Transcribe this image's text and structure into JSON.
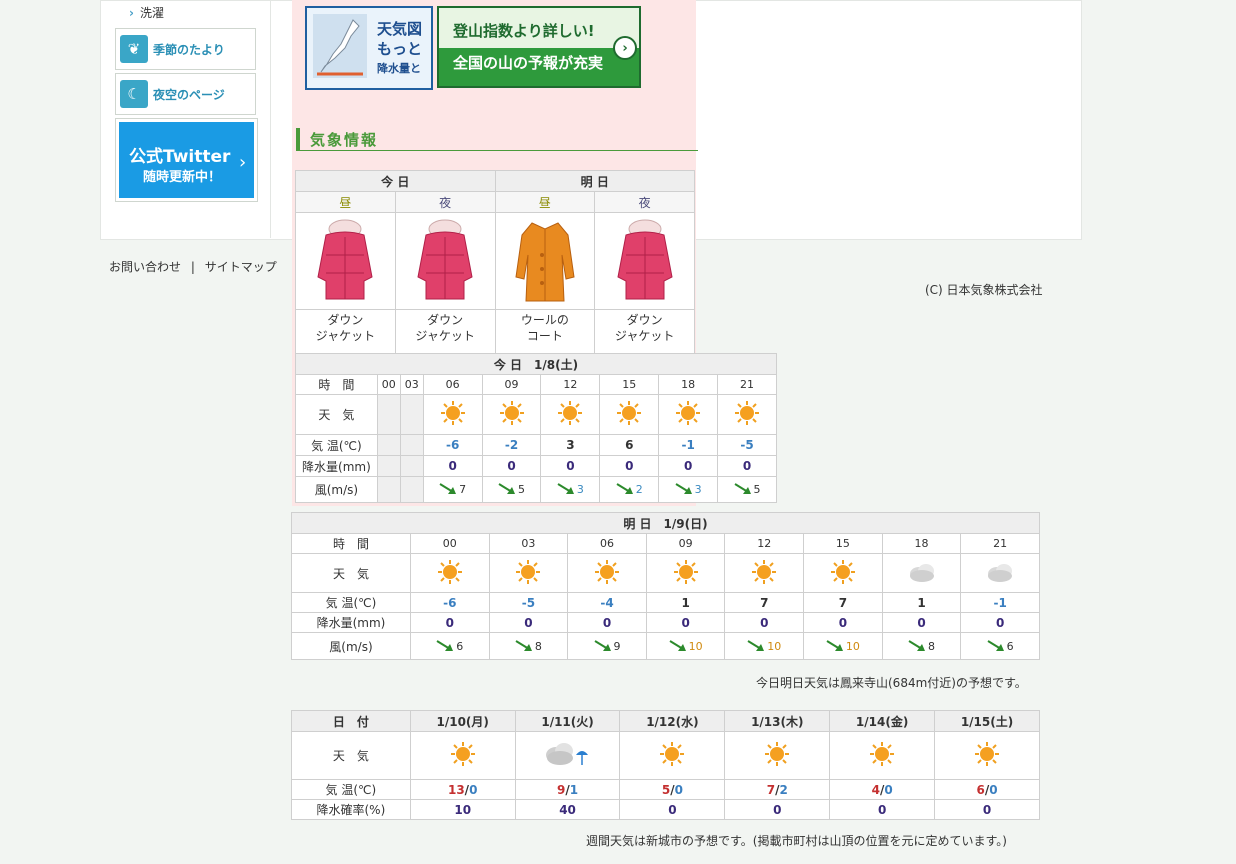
{
  "sidebar": {
    "laundry_label": "洗濯",
    "season_label": "季節のたより",
    "night_label": "夜空のページ",
    "twitter_line1": "公式Twitter",
    "twitter_line2": "随時更新中！"
  },
  "banners": {
    "weather_map_lines": [
      "天気図",
      "もっと",
      "降水量と"
    ],
    "mountain_line1": "登山指数より詳しい!",
    "mountain_line2": "全国の山の予報が充実"
  },
  "footer": {
    "contact": "お問い合わせ",
    "sep": "|",
    "sitemap": "サイトマップ",
    "copyright": "(C) 日本気象株式会社"
  },
  "section_title": "気象情報",
  "clothing": {
    "today": "今 日",
    "tomorrow": "明 日",
    "day_label": "昼",
    "night_label": "夜",
    "items": [
      {
        "line1": "ダウン",
        "line2": "ジャケット",
        "icon": "down-jacket-icon"
      },
      {
        "line1": "ダウン",
        "line2": "ジャケット",
        "icon": "down-jacket-icon"
      },
      {
        "line1": "ウールの",
        "line2": "コート",
        "icon": "wool-coat-icon"
      },
      {
        "line1": "ダウン",
        "line2": "ジャケット",
        "icon": "down-jacket-icon"
      }
    ]
  },
  "today_forecast": {
    "caption": "今 日　1/8(土)",
    "row_time": "時　間",
    "row_weather": "天　気",
    "row_temp": "気 温(℃)",
    "row_precip": "降水量(mm)",
    "row_wind": "風(m/s)",
    "times": [
      "00",
      "03",
      "06",
      "09",
      "12",
      "15",
      "18",
      "21"
    ],
    "weather": [
      "",
      "",
      "sunny",
      "sunny",
      "sunny",
      "sunny",
      "sunny",
      "sunny"
    ],
    "temps": [
      "",
      "",
      "-6",
      "-2",
      "3",
      "6",
      "-1",
      "-5"
    ],
    "precip": [
      "",
      "",
      "0",
      "0",
      "0",
      "0",
      "0",
      "0"
    ],
    "wind": [
      "",
      "",
      "7",
      "5",
      "3",
      "2",
      "3",
      "5"
    ]
  },
  "tomorrow_forecast": {
    "caption": "明 日　1/9(日)",
    "row_time": "時　間",
    "row_weather": "天　気",
    "row_temp": "気 温(℃)",
    "row_precip": "降水量(mm)",
    "row_wind": "風(m/s)",
    "times": [
      "00",
      "03",
      "06",
      "09",
      "12",
      "15",
      "18",
      "21"
    ],
    "weather": [
      "sunny",
      "sunny",
      "sunny",
      "sunny",
      "sunny",
      "sunny",
      "cloudy",
      "cloudy"
    ],
    "temps": [
      "-6",
      "-5",
      "-4",
      "1",
      "7",
      "7",
      "1",
      "-1"
    ],
    "precip": [
      "0",
      "0",
      "0",
      "0",
      "0",
      "0",
      "0",
      "0"
    ],
    "wind": [
      "6",
      "8",
      "9",
      "10",
      "10",
      "10",
      "8",
      "6"
    ]
  },
  "forecast_note": "今日明日天気は鳳来寺山(684m付近)の予想です。",
  "weekly": {
    "row_date": "日　付",
    "row_weather": "天　気",
    "row_temp": "気 温(℃)",
    "row_pop": "降水確率(%)",
    "dates": [
      "1/10(月)",
      "1/11(火)",
      "1/12(水)",
      "1/13(木)",
      "1/14(金)",
      "1/15(土)"
    ],
    "weather": [
      "sunny",
      "cloudy-rain",
      "sunny",
      "sunny",
      "sunny",
      "sunny"
    ],
    "highs": [
      "13",
      "9",
      "5",
      "7",
      "4",
      "6"
    ],
    "lows": [
      "0",
      "1",
      "0",
      "2",
      "0",
      "0"
    ],
    "slash": "/",
    "pop": [
      "10",
      "40",
      "0",
      "0",
      "0",
      "0"
    ]
  },
  "weekly_note": "週間天気は新城市の予想です。(掲載市町村は山頂の位置を元に定めています。)"
}
